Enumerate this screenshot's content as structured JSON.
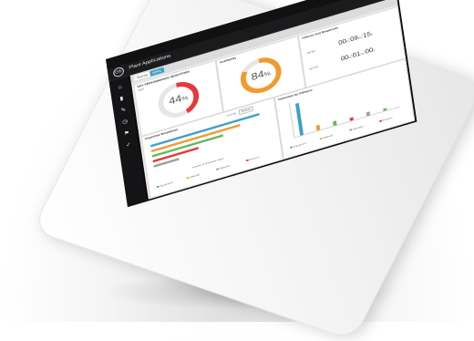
{
  "topbar": {
    "account": "",
    "badge_icon": "bell-icon",
    "settings_icon": "gear-icon",
    "user_icon": "user-icon"
  },
  "header": {
    "logo": "GE",
    "title": "Plant Applications",
    "action_label": ""
  },
  "tabs": [
    {
      "label": "Scene"
    },
    {
      "label": "KPIs"
    }
  ],
  "sidebar": {
    "items": [
      "home-icon",
      "chart-icon",
      "edit-icon",
      "clock-icon",
      "flag-icon",
      "check-icon"
    ]
  },
  "kpi_panel": {
    "title": "KEY PERFORMANCE INDICATORS",
    "sub": "OEE",
    "value": "44",
    "unit": "%",
    "fraction": 0.44,
    "color": "#e8363a"
  },
  "availability_panel": {
    "title": "Availability",
    "value": "84",
    "unit": "%",
    "fraction": 0.84,
    "color": "#f29a2e"
  },
  "time_panel": {
    "title": "Failures and Responses",
    "rows": [
      {
        "label": "MTBF",
        "value": "00",
        "v1": "09",
        "v2": "15"
      },
      {
        "label": "MTTR",
        "value": "00",
        "v1": "01",
        "v2": "00"
      }
    ]
  },
  "downtime_panel": {
    "title": "Downtime Breakdown",
    "filter_label": "View By",
    "filter_value": "Reason",
    "bars": [
      {
        "value": 0.95,
        "color": "#3fa0c8"
      },
      {
        "value": 0.78,
        "color": "#f29a2e"
      },
      {
        "value": 0.62,
        "color": "#66b85c"
      },
      {
        "value": 0.4,
        "color": "#e8363a"
      },
      {
        "value": 0.22,
        "color": "#9e9e9e"
      }
    ],
    "axis_title": "Number of Downtime (Min)",
    "legend": [
      {
        "name": "Equipment",
        "color": "#3fa0c8"
      },
      {
        "name": "Material",
        "color": "#f29a2e"
      },
      {
        "name": "Operator",
        "color": "#66b85c"
      },
      {
        "name": "Process",
        "color": "#e8363a"
      }
    ]
  },
  "category_panel": {
    "title": "Downtime by Category",
    "bars": [
      {
        "value": 0.95,
        "color": "#3fa0c8"
      },
      {
        "value": 0.15,
        "color": "#f29a2e"
      },
      {
        "value": 0.12,
        "color": "#66b85c"
      },
      {
        "value": 0.08,
        "color": "#e8363a"
      },
      {
        "value": 0.1,
        "color": "#9e9e9e"
      },
      {
        "value": 0.06,
        "color": "#66b85c"
      }
    ],
    "legend": [
      {
        "name": "Equipment",
        "color": "#3fa0c8"
      },
      {
        "name": "Material",
        "color": "#f29a2e"
      },
      {
        "name": "Operator",
        "color": "#66b85c"
      },
      {
        "name": "Process",
        "color": "#e8363a"
      }
    ]
  }
}
